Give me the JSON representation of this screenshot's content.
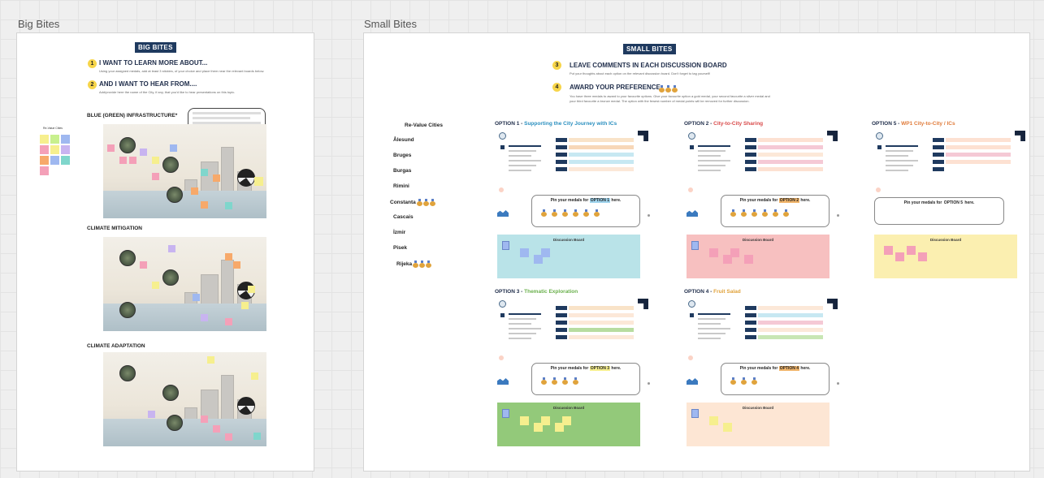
{
  "left_frame": {
    "label": "Big Bites",
    "tag": "BIG BITES",
    "steps": [
      {
        "num": "1",
        "title": "I WANT TO LEARN MORE ABOUT...",
        "text": "Using your assigned medals, add at least 3 stickies, of your choice and place them near the relevant boards below."
      },
      {
        "num": "2",
        "title": "AND I WANT TO HEAR FROM....",
        "text": "Add/provide here the name of the City, if any, that you'd like to hear presentations on this topic."
      }
    ],
    "sidebar_label": "Re-Value Cities",
    "sections": [
      {
        "title": "BLUE (GREEN) INFRASTRUCTURE*"
      },
      {
        "title": "CLIMATE MITIGATION"
      },
      {
        "title": "CLIMATE ADAPTATION"
      }
    ]
  },
  "right_frame": {
    "label": "Small Bites",
    "tag": "SMALL BITES",
    "steps": [
      {
        "num": "3",
        "title": "LEAVE COMMENTS IN EACH DISCUSSION BOARD",
        "text": "Put your thoughts about each option on the relevant discussion board. Don't forget to tag yourself!"
      },
      {
        "num": "4",
        "title": "AWARD YOUR PREFERENCE",
        "text": "You have three medals to award to your favourite options. Give your favourite option a gold medal, your second favourite a silver medal and your third favourite a bronze medal. The option with the fewest number of medal points will be removed for further discussion."
      }
    ],
    "cities_title": "Re-Value Cities",
    "cities": [
      {
        "name": "Ålesund",
        "medals": 0
      },
      {
        "name": "Bruges",
        "medals": 0
      },
      {
        "name": "Burgas",
        "medals": 0
      },
      {
        "name": "Rimini",
        "medals": 0
      },
      {
        "name": "Constanta",
        "medals": 3
      },
      {
        "name": "Cascais",
        "medals": 0
      },
      {
        "name": "İzmir",
        "medals": 0
      },
      {
        "name": "Pisek",
        "medals": 0
      },
      {
        "name": "Rijeka",
        "medals": 3
      }
    ],
    "options": [
      {
        "prefix": "OPTION 1 - ",
        "name": "Supporting the City Journey with ICs",
        "color": "#2a8fbf",
        "pin_pre": "Pin your medals for ",
        "pin_hl": "OPTION 1",
        "pin_post": " here.",
        "board": "Discussion Board",
        "board_color": "#b9e3e8"
      },
      {
        "prefix": "OPTION 2 - ",
        "name": "City-to-City Sharing",
        "color": "#d94a4a",
        "pin_pre": "Pin your medals for ",
        "pin_hl": "OPTION 2",
        "pin_post": " here.",
        "board": "Discussion Board",
        "board_color": "#f7c0c0"
      },
      {
        "prefix": "OPTION 5 - ",
        "name": "WP1 City-to-City / ICs",
        "color": "#e07b3a",
        "pin_pre": "Pin your medals for ",
        "pin_hl": "OPTION 5",
        "pin_post": " here.",
        "board": "Discussion Board",
        "board_color": "#fbefb0"
      },
      {
        "prefix": "OPTION 3 - ",
        "name": "Thematic Exploration",
        "color": "#6ab04c",
        "pin_pre": "Pin your medals for ",
        "pin_hl": "OPTION 3",
        "pin_post": " here.",
        "board": "Discussion Board",
        "board_color": "#93c97a"
      },
      {
        "prefix": "OPTION 4 - ",
        "name": "Fruit Salad",
        "color": "#e0a23a",
        "pin_pre": "Pin your medals for ",
        "pin_hl": "OPTION 4",
        "pin_post": " here.",
        "board": "Discussion Board",
        "board_color": "#fde6d4"
      }
    ]
  },
  "colors": {
    "navy": "#1f3a5f",
    "sticky_yellow": "#f6ef8e",
    "sticky_pink": "#f4a0b8",
    "sticky_blue": "#9fb8f0",
    "sticky_purple": "#c8b4f0",
    "sticky_orange": "#f7a96a",
    "sticky_teal": "#7fd6cc"
  }
}
